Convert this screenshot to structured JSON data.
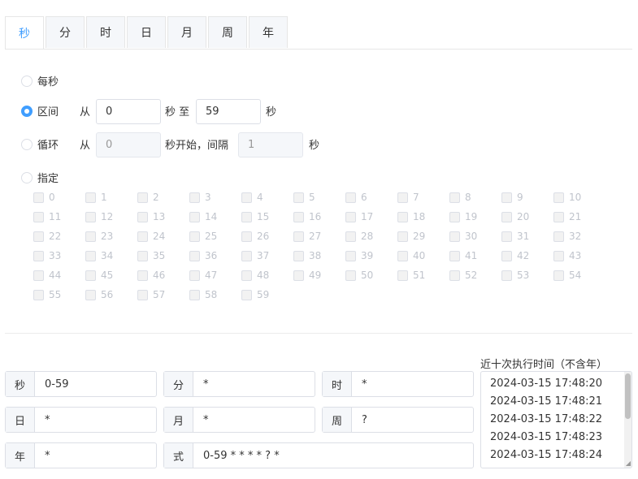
{
  "tabs": [
    "秒",
    "分",
    "时",
    "日",
    "月",
    "周",
    "年"
  ],
  "options": {
    "every": "每秒",
    "range": {
      "label": "区间",
      "from": "从",
      "from_value": "0",
      "mid": "秒 至",
      "to_value": "59",
      "suffix": "秒"
    },
    "loop": {
      "label": "循环",
      "from": "从",
      "start_value": "0",
      "mid": "秒开始，间隔",
      "step_value": "1",
      "suffix": "秒"
    },
    "specify": "指定"
  },
  "seconds": [
    "0",
    "1",
    "2",
    "3",
    "4",
    "5",
    "6",
    "7",
    "8",
    "9",
    "10",
    "11",
    "12",
    "13",
    "14",
    "15",
    "16",
    "17",
    "18",
    "19",
    "20",
    "21",
    "22",
    "23",
    "24",
    "25",
    "26",
    "27",
    "28",
    "29",
    "30",
    "31",
    "32",
    "33",
    "34",
    "35",
    "36",
    "37",
    "38",
    "39",
    "40",
    "41",
    "42",
    "43",
    "44",
    "45",
    "46",
    "47",
    "48",
    "49",
    "50",
    "51",
    "52",
    "53",
    "54",
    "55",
    "56",
    "57",
    "58",
    "59"
  ],
  "result": {
    "second": {
      "label": "秒",
      "value": "0-59"
    },
    "minute": {
      "label": "分",
      "value": "*"
    },
    "hour": {
      "label": "时",
      "value": "*"
    },
    "day": {
      "label": "日",
      "value": "*"
    },
    "month": {
      "label": "月",
      "value": "*"
    },
    "week": {
      "label": "周",
      "value": "?"
    },
    "year": {
      "label": "年",
      "value": "*"
    },
    "expression": {
      "label": "式",
      "value": "0-59 * * * * ? *"
    }
  },
  "next_runs_title": "近十次执行时间（不含年）",
  "next_runs": [
    "2024-03-15 17:48:20",
    "2024-03-15 17:48:21",
    "2024-03-15 17:48:22",
    "2024-03-15 17:48:23",
    "2024-03-15 17:48:24"
  ],
  "colors": {
    "accent": "#409eff",
    "border": "#dcdfe6",
    "disabled_text": "#c0c4cc"
  }
}
